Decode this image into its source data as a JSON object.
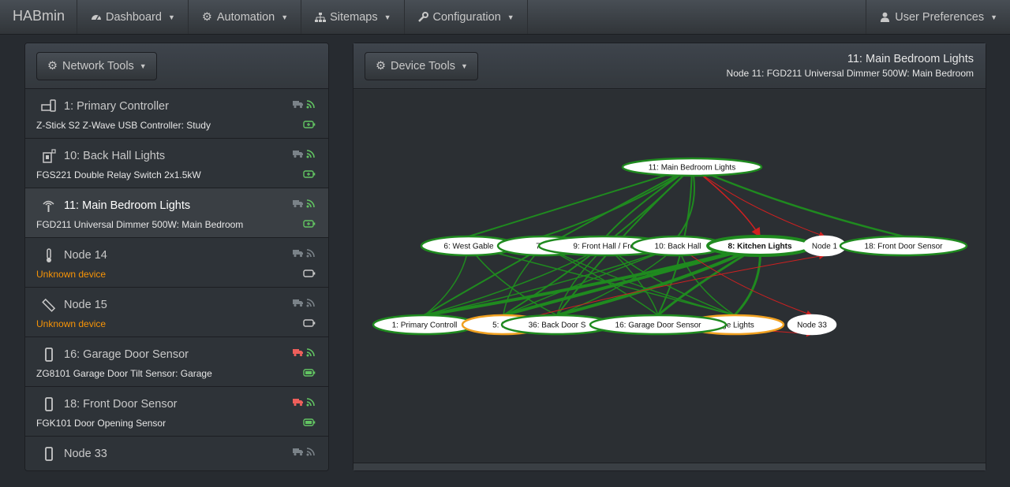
{
  "navbar": {
    "brand": "HABmin",
    "items": [
      {
        "label": "Dashboard",
        "icon": "dashboard-icon"
      },
      {
        "label": "Automation",
        "icon": "cogs-icon"
      },
      {
        "label": "Sitemaps",
        "icon": "sitemap-icon"
      },
      {
        "label": "Configuration",
        "icon": "wrench-icon"
      }
    ],
    "user": {
      "label": "User Preferences",
      "icon": "user-icon"
    }
  },
  "left_panel": {
    "button": "Network Tools",
    "devices": [
      {
        "title": "1: Primary Controller",
        "subtitle": "Z-Stick S2 Z-Wave USB Controller: Study",
        "icon": "controller-icon",
        "status_color": "#62c462",
        "battery": "green-plug",
        "warn": false
      },
      {
        "title": "10: Back Hall Lights",
        "subtitle": "FGS221 Double Relay Switch 2x1.5kW",
        "icon": "switch-icon",
        "status_color": "#62c462",
        "battery": "green-plug",
        "warn": false
      },
      {
        "title": "11: Main Bedroom Lights",
        "subtitle": "FGD211 Universal Dimmer 500W: Main Bedroom",
        "icon": "dimmer-icon",
        "status_color": "#62c462",
        "battery": "green-plug",
        "warn": false
      },
      {
        "title": "Node 14",
        "subtitle": "Unknown device",
        "icon": "thermometer-icon",
        "status_color": "#7a8288",
        "battery": "grey-empty",
        "warn": true
      },
      {
        "title": "Node 15",
        "subtitle": "Unknown device",
        "icon": "ruler-icon",
        "status_color": "#7a8288",
        "battery": "grey-empty",
        "warn": true
      },
      {
        "title": "16: Garage Door Sensor",
        "subtitle": "ZG8101 Garage Door Tilt Sensor: Garage",
        "icon": "mobile-icon",
        "status_color": "#ee5f5b",
        "battery": "green-full",
        "warn": false
      },
      {
        "title": "18: Front Door Sensor",
        "subtitle": "FGK101 Door Opening Sensor",
        "icon": "mobile-icon",
        "status_color": "#ee5f5b",
        "battery": "green-full",
        "warn": false
      },
      {
        "title": "Node 33",
        "subtitle": "",
        "icon": "mobile-icon",
        "status_color": "#7a8288",
        "battery": "none",
        "warn": false
      }
    ]
  },
  "right_panel": {
    "button": "Device Tools",
    "title": "11: Main Bedroom Lights",
    "subtitle": "Node 11: FGD211 Universal Dimmer 500W: Main Bedroom"
  },
  "network_graph": {
    "nodes": [
      {
        "id": "n11",
        "label": "11: Main Bedroom Lights",
        "style": "green",
        "bold": false
      },
      {
        "id": "n6",
        "label": "6: West Gable",
        "style": "green",
        "bold": false
      },
      {
        "id": "n7",
        "label": "7: E",
        "style": "green",
        "bold": false
      },
      {
        "id": "n9",
        "label": "9: Front Hall / Fron",
        "style": "green",
        "bold": false
      },
      {
        "id": "n10",
        "label": "10: Back Hall",
        "style": "green",
        "bold": false
      },
      {
        "id": "n8",
        "label": "8: Kitchen Lights",
        "style": "green",
        "bold": true
      },
      {
        "id": "n14",
        "label": "Node 1",
        "style": "plain",
        "bold": false
      },
      {
        "id": "n18",
        "label": "18: Front Door Sensor",
        "style": "green",
        "bold": false
      },
      {
        "id": "n1",
        "label": "1: Primary Controll",
        "style": "green",
        "bold": false
      },
      {
        "id": "n5",
        "label": "5: Lou",
        "style": "orange",
        "bold": false
      },
      {
        "id": "n36",
        "label": "36: Back Door S",
        "style": "green",
        "bold": false
      },
      {
        "id": "n4",
        "label": "rage Lights",
        "style": "orange",
        "bold": false
      },
      {
        "id": "n16",
        "label": "16: Garage Door Sensor",
        "style": "green",
        "bold": false
      },
      {
        "id": "n33",
        "label": "Node 33",
        "style": "plain",
        "bold": false
      }
    ],
    "colors": {
      "green": "#1f8a1f",
      "red": "#d02020",
      "orange": "#f0a020"
    }
  }
}
